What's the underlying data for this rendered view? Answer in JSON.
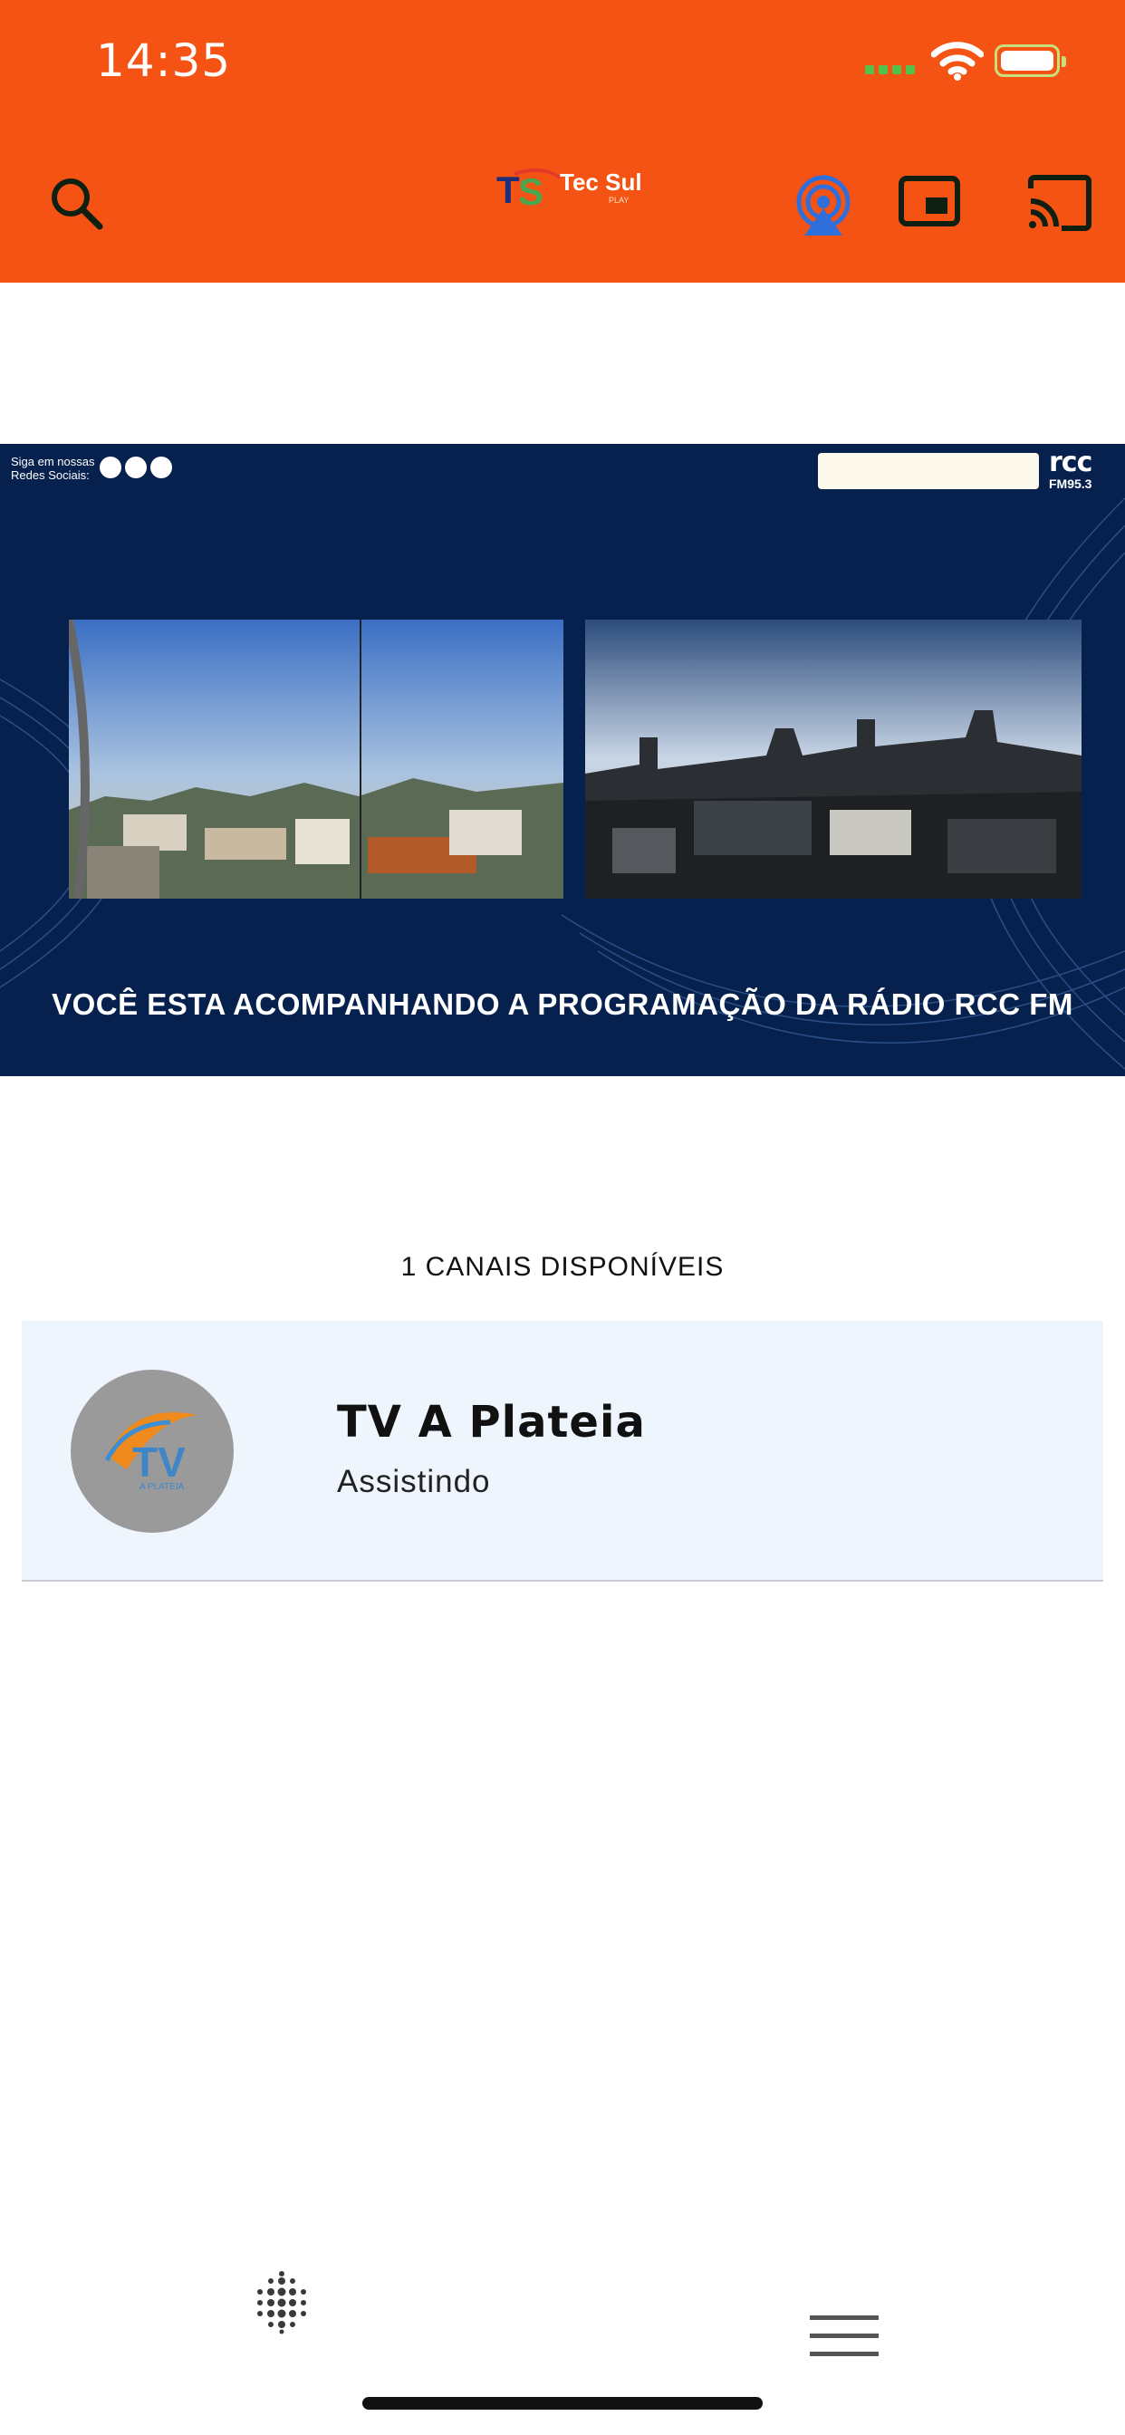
{
  "status_bar": {
    "time": "14:35"
  },
  "header": {
    "logo_text": "Tec Sul",
    "logo_subtext": "PLAY",
    "icons": [
      "search-icon",
      "airplay-icon",
      "picture-in-picture-icon",
      "cast-icon"
    ],
    "colors": {
      "background": "#f55314",
      "airplay": "#2f6fdc"
    }
  },
  "video": {
    "follow_text_line1": "Siga em nossas",
    "follow_text_line2": "Redes Sociais:",
    "social_icons": [
      "facebook-icon",
      "instagram-icon",
      "spotify-icon"
    ],
    "search_placeholder": "",
    "station_logo": "rcc",
    "station_sub": "FM95.3",
    "caption": "VOCÊ ESTA ACOMPANHANDO A PROGRAMAÇÃO DA RÁDIO RCC FM",
    "colors": {
      "background": "#06214d"
    }
  },
  "channels": {
    "count_label": "1 CANAIS DISPONÍVEIS",
    "items": [
      {
        "name": "TV A Plateia",
        "status": "Assistindo",
        "logo": "TV",
        "logo_sub": "A PLATEIA"
      }
    ]
  },
  "bottom_bar": {
    "icons": [
      "dots-grid-icon",
      "menu-icon"
    ]
  }
}
